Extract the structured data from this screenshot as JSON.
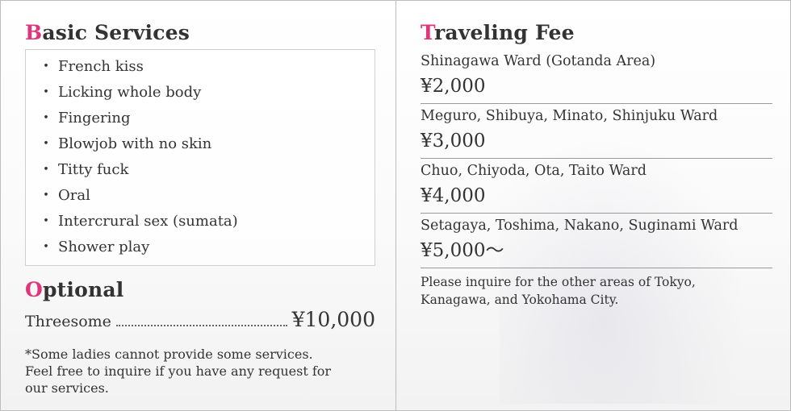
{
  "basic": {
    "title_first": "B",
    "title_rest": "asic Services",
    "items": [
      "French kiss",
      "Licking whole body",
      "Fingering",
      "Blowjob with no skin",
      "Titty fuck",
      "Oral",
      "Intercrural sex (sumata)",
      "Shower play"
    ],
    "bullet": "・"
  },
  "optional": {
    "title_first": "O",
    "title_rest": "ptional",
    "item": "Threesome",
    "price": "¥10,000",
    "note": "*Some ladies cannot provide some services. Feel free to inquire if you have any request for our services."
  },
  "travel": {
    "title_first": "T",
    "title_rest": "raveling Fee",
    "fees": [
      {
        "area": "Shinagawa Ward (Gotanda Area)",
        "price": "¥2,000"
      },
      {
        "area": "Meguro, Shibuya, Minato, Shinjuku Ward",
        "price": "¥3,000"
      },
      {
        "area": "Chuo, Chiyoda, Ota, Taito Ward",
        "price": "¥4,000"
      },
      {
        "area": "Setagaya, Toshima, Nakano, Suginami Ward",
        "price": "¥5,000～"
      }
    ],
    "note": "Please inquire for the other areas of Tokyo, Kanagawa, and Yokohama City."
  },
  "colors": {
    "accent": "#e0357a",
    "text": "#333333",
    "border": "#bdbdbd"
  }
}
